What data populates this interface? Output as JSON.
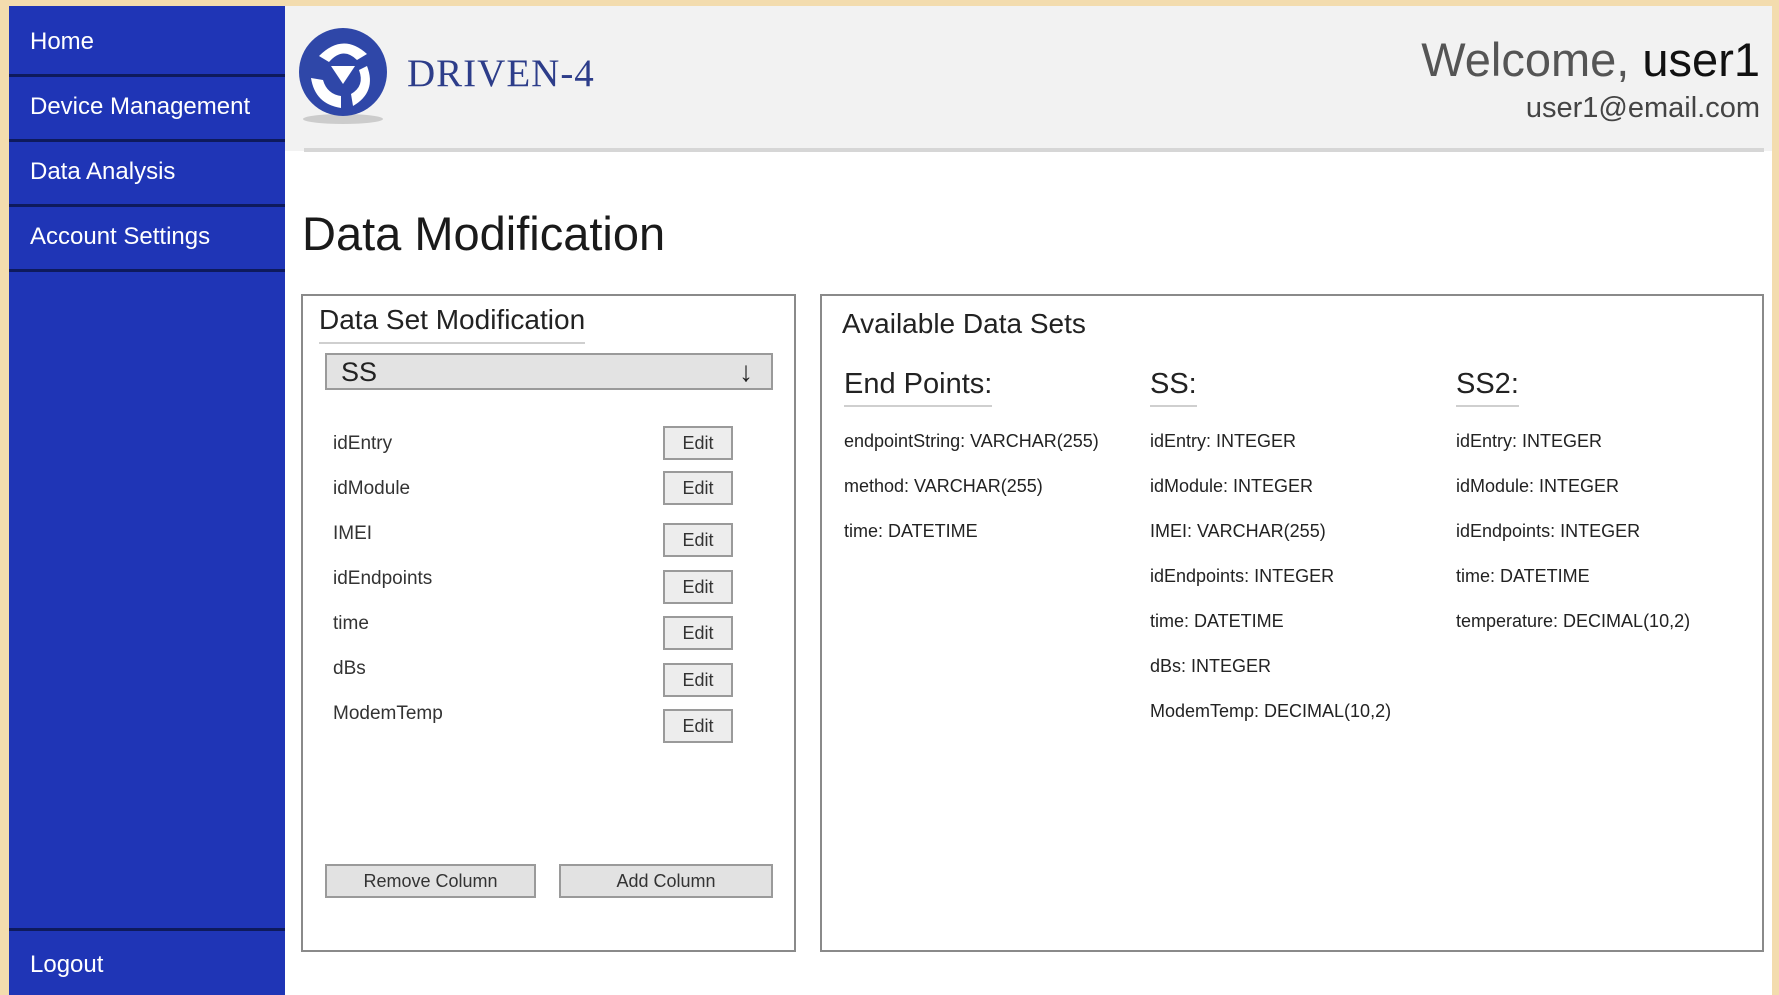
{
  "sidebar": {
    "items": [
      {
        "label": "Home"
      },
      {
        "label": "Device Management"
      },
      {
        "label": "Data Analysis"
      },
      {
        "label": "Account Settings"
      }
    ],
    "logout_label": "Logout"
  },
  "header": {
    "brand": "DRIVEN-4",
    "welcome_prefix": "Welcome,",
    "username": "user1",
    "email": "user1@email.com",
    "logo_icon": "driven-logo-icon"
  },
  "page": {
    "title": "Data Modification"
  },
  "modification": {
    "title": "Data Set Modification",
    "selected_dataset": "SS",
    "dropdown_arrow": "↓",
    "fields": [
      "idEntry",
      "idModule",
      "IMEI",
      "idEndpoints",
      "time",
      "dBs",
      "ModemTemp"
    ],
    "edit_label": "Edit",
    "remove_column_label": "Remove Column",
    "add_column_label": "Add Column"
  },
  "available": {
    "title": "Available Data Sets",
    "datasets": [
      {
        "name": "End Points:",
        "fields": [
          "endpointString: VARCHAR(255)",
          "method: VARCHAR(255)",
          "time: DATETIME"
        ]
      },
      {
        "name": "SS:",
        "fields": [
          "idEntry: INTEGER",
          "idModule: INTEGER",
          "IMEI: VARCHAR(255)",
          "idEndpoints: INTEGER",
          "time: DATETIME",
          "dBs: INTEGER",
          "ModemTemp: DECIMAL(10,2)"
        ]
      },
      {
        "name": "SS2:",
        "fields": [
          "idEntry: INTEGER",
          "idModule: INTEGER",
          "idEndpoints: INTEGER",
          "time: DATETIME",
          "temperature: DECIMAL(10,2)"
        ]
      }
    ]
  },
  "colors": {
    "sidebar": "#1f35b6",
    "brand": "#2d3d8a",
    "page_background": "#f3dcae"
  }
}
